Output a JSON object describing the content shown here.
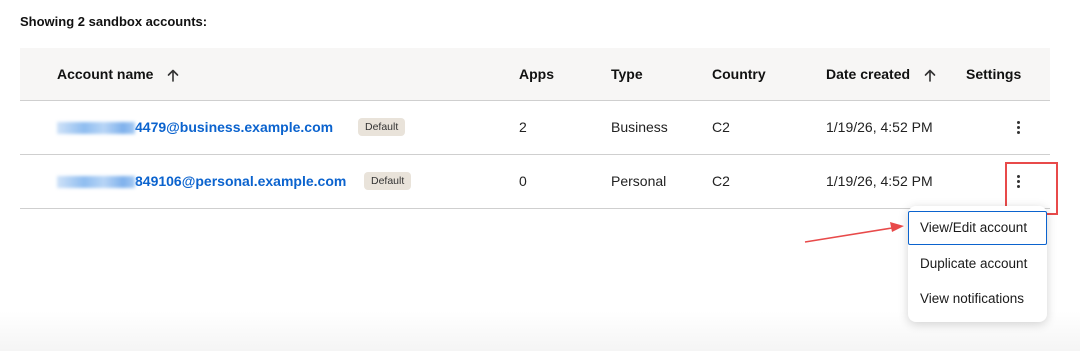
{
  "heading": "Showing 2 sandbox accounts:",
  "table": {
    "columns": {
      "account_name": "Account name",
      "apps": "Apps",
      "type": "Type",
      "country": "Country",
      "date_created": "Date created",
      "settings": "Settings"
    },
    "rows": [
      {
        "email_visible": "4479@business.example.com",
        "badge": "Default",
        "apps": "2",
        "type": "Business",
        "country": "C2",
        "date": "1/19/26, 4:52 PM"
      },
      {
        "email_visible": "849106@personal.example.com",
        "badge": "Default",
        "apps": "0",
        "type": "Personal",
        "country": "C2",
        "date": "1/19/26, 4:52 PM"
      }
    ]
  },
  "menu": {
    "items": [
      {
        "label": "View/Edit account"
      },
      {
        "label": "Duplicate account"
      },
      {
        "label": "View notifications"
      }
    ]
  },
  "colors": {
    "link": "#0b63ce",
    "annotation": "#e84a4a",
    "badge_bg": "#e9e3da",
    "header_bg": "#f7f6f5"
  }
}
